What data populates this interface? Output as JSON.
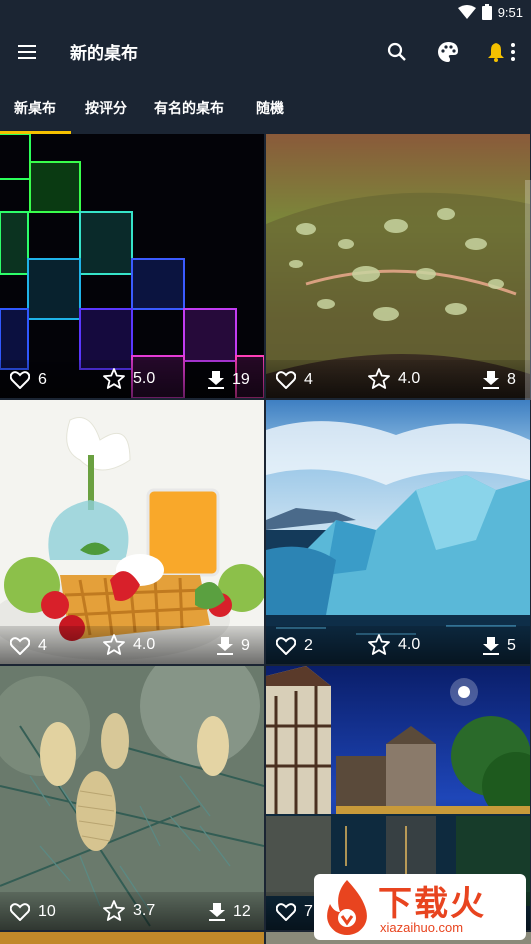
{
  "status_bar": {
    "time": "9:51"
  },
  "app_bar": {
    "title": "新的桌布"
  },
  "tabs": [
    {
      "label": "新桌布",
      "selected": true
    },
    {
      "label": "按评分",
      "selected": false
    },
    {
      "label": "有名的桌布",
      "selected": false
    },
    {
      "label": "随機",
      "selected": false
    }
  ],
  "wallpapers": [
    {
      "subject": "neon squares",
      "likes": "6",
      "rating": "5.0",
      "downloads": "19"
    },
    {
      "subject": "water drops on leaf",
      "likes": "4",
      "rating": "4.0",
      "downloads": "8"
    },
    {
      "subject": "breakfast waffles",
      "likes": "4",
      "rating": "4.0",
      "downloads": "9"
    },
    {
      "subject": "iceberg",
      "likes": "2",
      "rating": "4.0",
      "downloads": "5"
    },
    {
      "subject": "pine cones",
      "likes": "10",
      "rating": "3.7",
      "downloads": "12"
    },
    {
      "subject": "canal at night",
      "likes": "7",
      "rating": "",
      "downloads": ""
    }
  ],
  "watermark": {
    "brand": "下载火",
    "domain": "xiazaihuo.com"
  },
  "colors": {
    "background": "#1b2533",
    "accent": "#f5c100",
    "watermark": "#e8441f"
  }
}
